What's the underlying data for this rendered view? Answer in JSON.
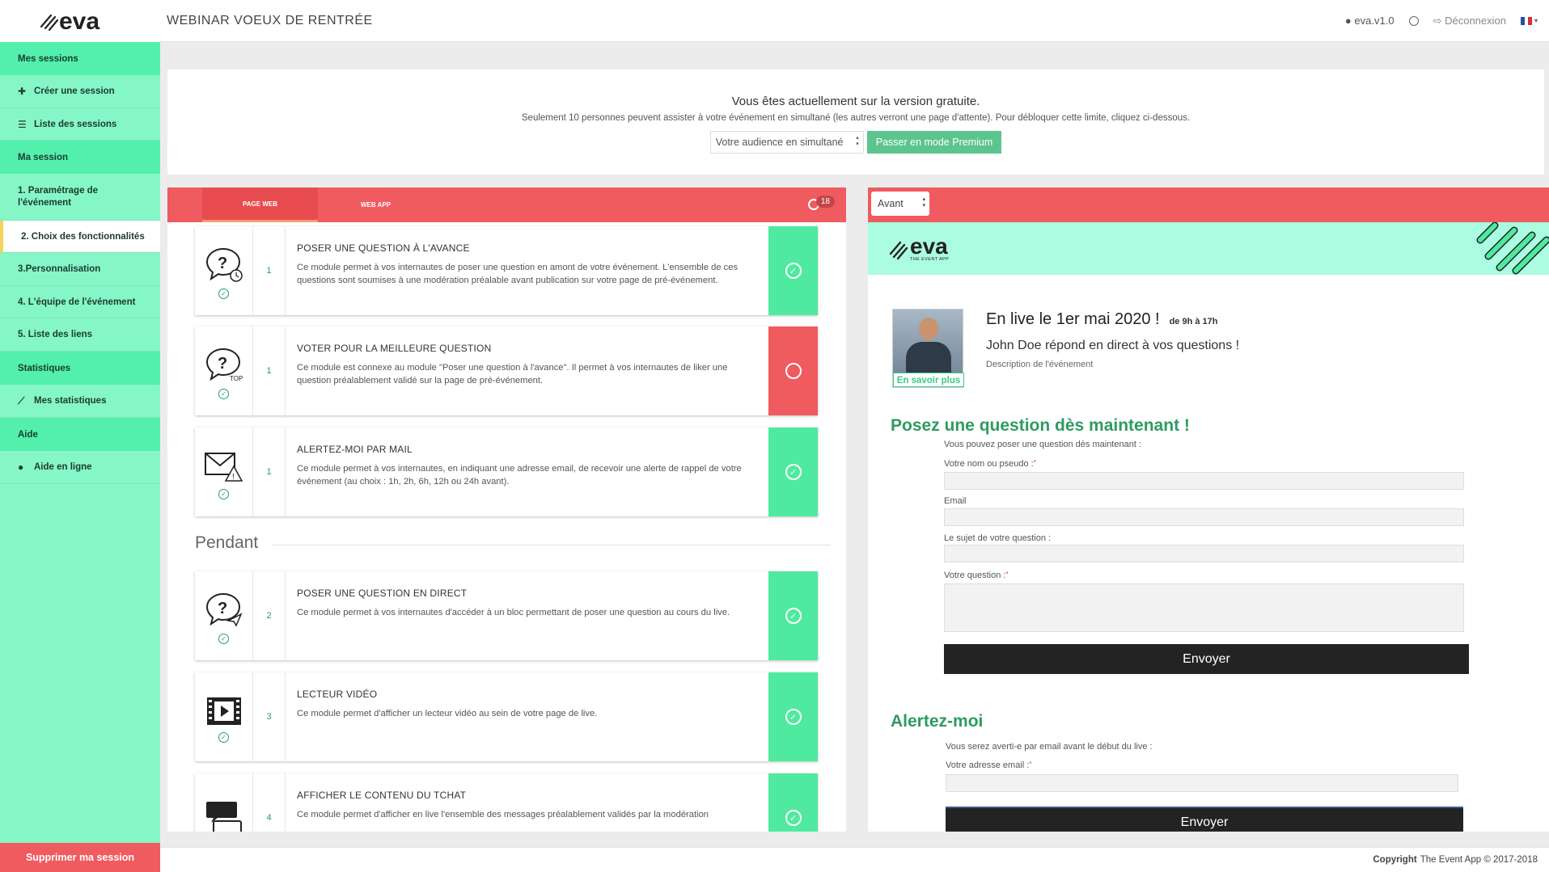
{
  "topbar": {
    "title": "WEBINAR VOEUX DE RENTRÉE",
    "version": "eva.v1.0",
    "logout": "Déconnexion"
  },
  "sidebar": {
    "sections": [
      {
        "label": "Mes sessions"
      },
      {
        "label": "Ma session"
      },
      {
        "label": "Statistiques"
      },
      {
        "label": "Aide"
      }
    ],
    "items": [
      {
        "label": "Créer une session",
        "icon": "plus-icon"
      },
      {
        "label": "Liste des sessions",
        "icon": "list-icon"
      },
      {
        "label": "1. Paramétrage de l'événement"
      },
      {
        "label": "2. Choix des fonctionnalités"
      },
      {
        "label": "3.Personnalisation"
      },
      {
        "label": "4. L'équipe de l'événement"
      },
      {
        "label": "5. Liste des liens"
      },
      {
        "label": "Mes statistiques",
        "icon": "chart-icon"
      },
      {
        "label": "Aide en ligne",
        "icon": "help-icon"
      }
    ],
    "delete_label": "Supprimer ma session"
  },
  "banner": {
    "title": "Vous êtes actuellement sur la version gratuite.",
    "text": "Seulement 10 personnes peuvent assister à votre événement en simultané (les autres verront une page d'attente). Pour débloquer cette limite, cliquez ci-dessous.",
    "audience_select": "Votre audience en simultané",
    "premium_button": "Passer en mode Premium"
  },
  "left_panel": {
    "tabs": [
      {
        "label": "PAGE WEB"
      },
      {
        "label": "WEB APP"
      }
    ],
    "counter": "18",
    "section_pendant": "Pendant",
    "modules": [
      {
        "num": "1",
        "title": "POSER UNE QUESTION À L'AVANCE",
        "desc": "Ce module permet à vos internautes de poser une question en amont de votre événement. L'ensemble de ces questions sont soumises à une modération préalable avant publication sur votre page de pré-événement.",
        "icon": "question-clock-icon",
        "enabled": true
      },
      {
        "num": "1",
        "title": "VOTER POUR LA MEILLEURE QUESTION",
        "desc": "Ce module est connexe au module \"Poser une question à l'avance\". Il permet à vos internautes de liker une question préalablement validé sur la page de pré-événement.",
        "icon": "question-top-icon",
        "icon_label": "TOP",
        "enabled": false
      },
      {
        "num": "1",
        "title": "ALERTEZ-MOI PAR MAIL",
        "desc": "Ce module permet à vos internautes, en indiquant une adresse email, de recevoir une alerte de rappel de votre événement (au choix : 1h, 2h, 6h, 12h ou 24h avant).",
        "icon": "mail-alert-icon",
        "enabled": true
      },
      {
        "num": "2",
        "title": "POSER UNE QUESTION EN DIRECT",
        "desc": "Ce module permet à vos internautes d'accéder à un bloc permettant de poser une question au cours du live.",
        "icon": "question-send-icon",
        "enabled": true
      },
      {
        "num": "3",
        "title": "LECTEUR VIDÉO",
        "desc": "Ce module permet d'afficher un lecteur vidéo au sein de votre page de live.",
        "icon": "video-icon",
        "enabled": true
      },
      {
        "num": "4",
        "title": "AFFICHER LE CONTENU DU TCHAT",
        "desc": "Ce module permet d'afficher en live l'ensemble des messages préalablement validés par la modération",
        "icon": "chat-icon",
        "enabled": true
      }
    ]
  },
  "right_panel": {
    "phase_select": "Avant",
    "brand_sub": "THE EVENT APP",
    "event": {
      "date": "En live le 1er mai 2020 !",
      "hours": "de 9h à 17h",
      "subtitle": "John Doe répond en direct à vos questions !",
      "description": "Description de l'événement",
      "more_link": "En savoir plus"
    },
    "question_form": {
      "heading": "Posez une question dès maintenant !",
      "intro": "Vous pouvez poser une question dès maintenant :",
      "name_label": "Votre nom ou pseudo :",
      "email_label": "Email",
      "subject_label": "Le sujet de votre question :",
      "question_label": "Votre question :",
      "submit": "Envoyer"
    },
    "alert_form": {
      "heading": "Alertez-moi",
      "intro": "Vous serez averti-e par email avant le début du live :",
      "email_label": "Votre adresse email :",
      "submit": "Envoyer"
    }
  },
  "footer": {
    "copyright_bold": "Copyright",
    "copyright_text": "The Event App © 2017-2018"
  },
  "colors": {
    "sidebar_bg": "#85f7c6",
    "sidebar_section": "#52f0ac",
    "accent_red": "#ef5b5f",
    "enabled_green": "#4fea9f",
    "heading_green": "#2e9b62",
    "premium_green": "#5cc48e"
  }
}
